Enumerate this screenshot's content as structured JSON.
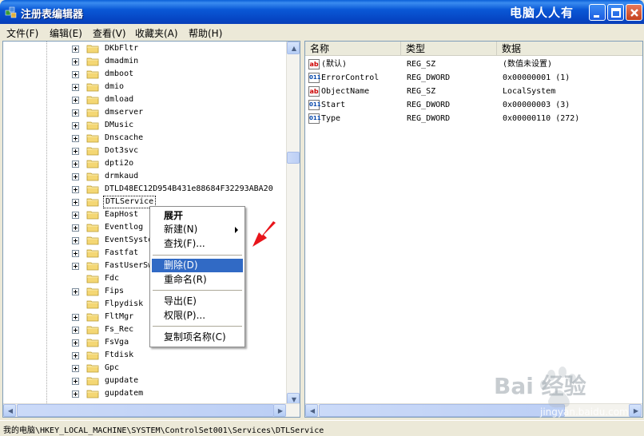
{
  "window": {
    "title": "注册表编辑器",
    "corner_watermark": "电脑人人有"
  },
  "menubar": [
    {
      "label": "文件(F)"
    },
    {
      "label": "编辑(E)"
    },
    {
      "label": "查看(V)"
    },
    {
      "label": "收藏夹(A)"
    },
    {
      "label": "帮助(H)"
    }
  ],
  "tree": {
    "selected_index": 12,
    "items": [
      {
        "label": "DKbFltr",
        "expandable": true
      },
      {
        "label": "dmadmin",
        "expandable": true
      },
      {
        "label": "dmboot",
        "expandable": true
      },
      {
        "label": "dmio",
        "expandable": true
      },
      {
        "label": "dmload",
        "expandable": true
      },
      {
        "label": "dmserver",
        "expandable": true
      },
      {
        "label": "DMusic",
        "expandable": true
      },
      {
        "label": "Dnscache",
        "expandable": true
      },
      {
        "label": "Dot3svc",
        "expandable": true
      },
      {
        "label": "dpti2o",
        "expandable": true
      },
      {
        "label": "drmkaud",
        "expandable": true
      },
      {
        "label": "DTLD48EC12D954B431e88684F32293ABA20",
        "expandable": true
      },
      {
        "label": "DTLService",
        "expandable": true
      },
      {
        "label": "EapHost",
        "expandable": true
      },
      {
        "label": "Eventlog",
        "expandable": true
      },
      {
        "label": "EventSyste",
        "expandable": true
      },
      {
        "label": "Fastfat",
        "expandable": true
      },
      {
        "label": "FastUserSw",
        "expandable": true
      },
      {
        "label": "Fdc",
        "expandable": false
      },
      {
        "label": "Fips",
        "expandable": true
      },
      {
        "label": "Flpydisk",
        "expandable": false
      },
      {
        "label": "FltMgr",
        "expandable": true
      },
      {
        "label": "Fs_Rec",
        "expandable": true
      },
      {
        "label": "FsVga",
        "expandable": true
      },
      {
        "label": "Ftdisk",
        "expandable": true
      },
      {
        "label": "Gpc",
        "expandable": true
      },
      {
        "label": "gupdate",
        "expandable": true
      },
      {
        "label": "gupdatem",
        "expandable": true
      }
    ]
  },
  "list": {
    "columns": [
      "名称",
      "类型",
      "数据"
    ],
    "rows": [
      {
        "icon": "ab",
        "name": "(默认)",
        "type": "REG_SZ",
        "data": "(数值未设置)"
      },
      {
        "icon": "dw",
        "name": "ErrorControl",
        "type": "REG_DWORD",
        "data": "0x00000001 (1)"
      },
      {
        "icon": "ab",
        "name": "ObjectName",
        "type": "REG_SZ",
        "data": "LocalSystem"
      },
      {
        "icon": "dw",
        "name": "Start",
        "type": "REG_DWORD",
        "data": "0x00000003 (3)"
      },
      {
        "icon": "dw",
        "name": "Type",
        "type": "REG_DWORD",
        "data": "0x00000110 (272)"
      }
    ]
  },
  "context_menu": {
    "items": [
      {
        "label": "展开",
        "bold": true
      },
      {
        "label": "新建(N)",
        "submenu": true
      },
      {
        "label": "查找(F)..."
      },
      {
        "label": "删除(D)",
        "highlighted": true
      },
      {
        "label": "重命名(R)"
      },
      {
        "label": "导出(E)"
      },
      {
        "label": "权限(P)..."
      },
      {
        "label": "复制项名称(C)"
      }
    ]
  },
  "statusbar": {
    "path": "我的电脑\\HKEY_LOCAL_MACHINE\\SYSTEM\\ControlSet001\\Services\\DTLService"
  },
  "watermark": {
    "brand": "Bai 经验",
    "url": "jingyan.baidu.com"
  },
  "colors": {
    "titlebar": "#0a58d6",
    "highlight": "#316ac5",
    "annotation_arrow": "#e8141a"
  }
}
